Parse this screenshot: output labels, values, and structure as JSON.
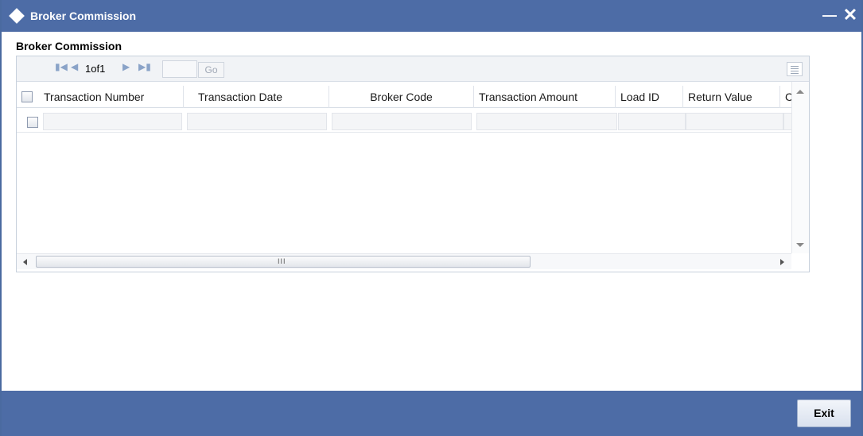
{
  "window": {
    "title": "Broker Commission"
  },
  "section": {
    "title": "Broker Commission"
  },
  "pager": {
    "page_info": "1of1",
    "page_input_value": "",
    "go_label": "Go"
  },
  "table": {
    "columns": [
      "Transaction Number",
      "Transaction Date",
      "Broker Code",
      "Transaction Amount",
      "Load ID",
      "Return Value",
      "C"
    ],
    "rows": [
      [
        "",
        "",
        "",
        "",
        "",
        "",
        ""
      ]
    ]
  },
  "footer": {
    "exit_label": "Exit"
  },
  "colors": {
    "titlebar": "#4d6ca6",
    "footer": "#4d6ca6"
  },
  "icons": [
    "diamond-icon",
    "minimize-icon",
    "close-icon",
    "first-page-icon",
    "prev-page-icon",
    "next-page-icon",
    "last-page-icon",
    "column-settings-icon"
  ]
}
